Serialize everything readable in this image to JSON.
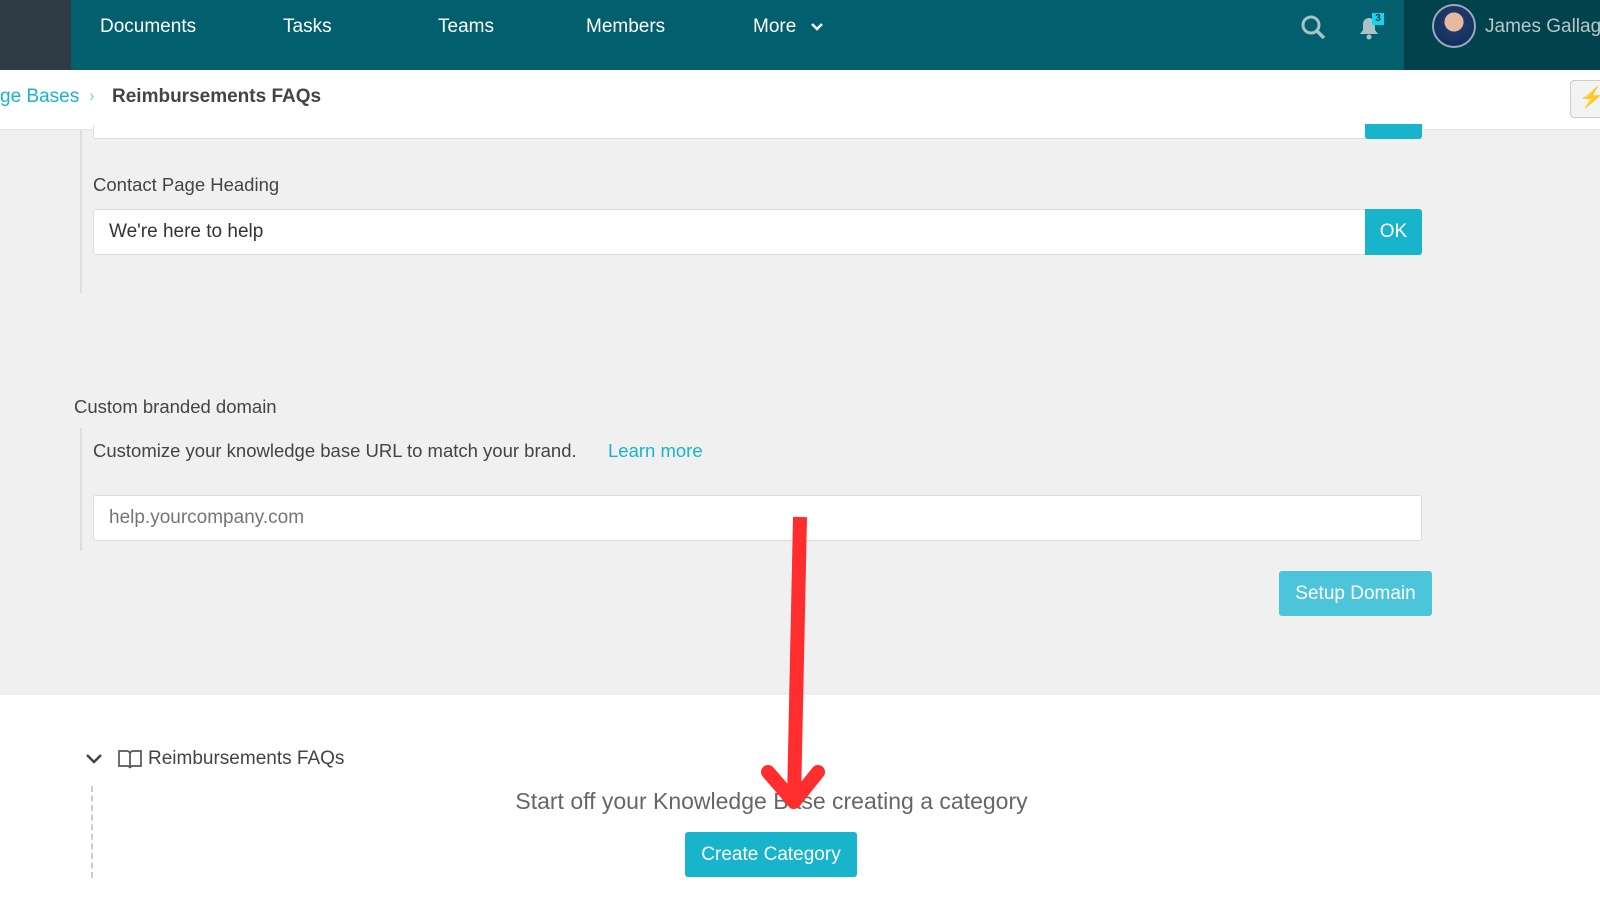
{
  "nav": {
    "items": [
      "Documents",
      "Tasks",
      "Teams",
      "Members",
      "More"
    ],
    "notification_count": "3",
    "user_name": "James Gallag"
  },
  "breadcrumb": {
    "parent": "ge Bases",
    "current": "Reimbursements FAQs"
  },
  "contact": {
    "label": "Contact Page Heading",
    "value": "We're here to help",
    "ok": "OK"
  },
  "domain": {
    "label": "Custom branded domain",
    "description": "Customize your knowledge base URL to match your brand.",
    "learn_more": "Learn more",
    "placeholder": "help.yourcompany.com",
    "button": "Setup Domain"
  },
  "tree": {
    "root": "Reimbursements FAQs"
  },
  "empty": {
    "message": "Start off your Knowledge Base creating a category",
    "button": "Create Category"
  },
  "colors": {
    "nav": "#025f6d",
    "accent": "#17b4cc",
    "annotation_arrow": "#ff2d2d"
  }
}
